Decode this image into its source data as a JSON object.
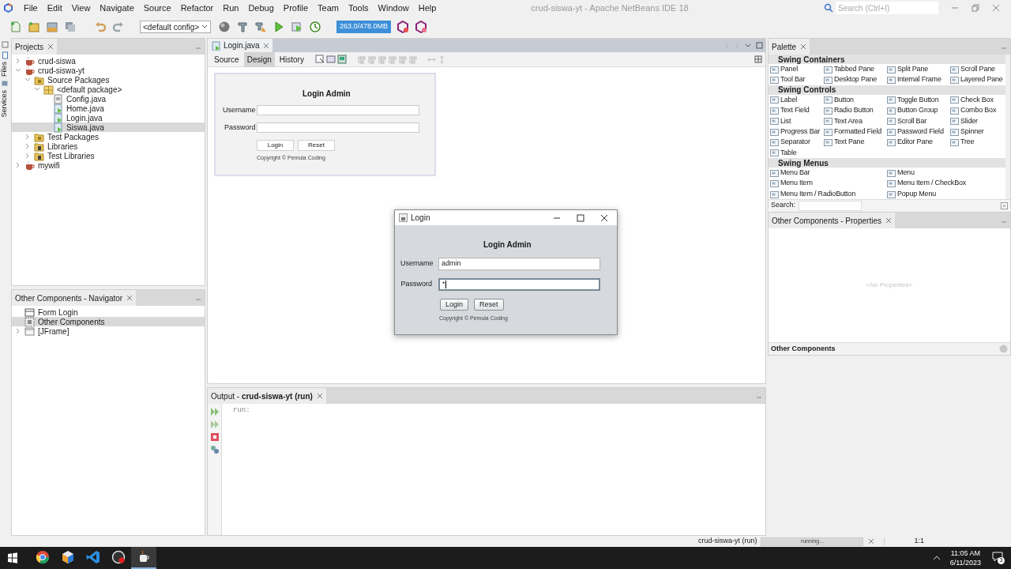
{
  "window": {
    "title": "crud-siswa-yt - Apache NetBeans IDE 18"
  },
  "menu": [
    "File",
    "Edit",
    "View",
    "Navigate",
    "Source",
    "Refactor",
    "Run",
    "Debug",
    "Profile",
    "Team",
    "Tools",
    "Window",
    "Help"
  ],
  "search": {
    "placeholder": "Search (Ctrl+I)"
  },
  "toolbar": {
    "config": "<default config>",
    "memory": "263.0/478.0MB"
  },
  "side_tabs": [
    "Files",
    "Services"
  ],
  "projects": {
    "title": "Projects",
    "tree": [
      {
        "label": "crud-siswa",
        "kind": "project",
        "expanded": false,
        "selected": false
      },
      {
        "label": "crud-siswa-yt",
        "kind": "project",
        "expanded": true,
        "selected": false,
        "children": [
          {
            "label": "Source Packages",
            "kind": "folder",
            "expanded": true,
            "selected": false,
            "children": [
              {
                "label": "<default package>",
                "kind": "package",
                "expanded": true,
                "selected": false,
                "children": [
                  {
                    "label": "Config.java",
                    "kind": "class",
                    "selected": false
                  },
                  {
                    "label": "Home.java",
                    "kind": "form",
                    "selected": false
                  },
                  {
                    "label": "Login.java",
                    "kind": "form",
                    "selected": false
                  },
                  {
                    "label": "Siswa.java",
                    "kind": "form",
                    "selected": true
                  }
                ]
              }
            ]
          },
          {
            "label": "Test Packages",
            "kind": "folder",
            "expanded": false,
            "selected": false
          },
          {
            "label": "Libraries",
            "kind": "library",
            "expanded": false,
            "selected": false
          },
          {
            "label": "Test Libraries",
            "kind": "library",
            "expanded": false,
            "selected": false
          }
        ]
      },
      {
        "label": "mywifi",
        "kind": "project",
        "expanded": false,
        "selected": false
      }
    ]
  },
  "navigator": {
    "title": "Other Components - Navigator",
    "tree": [
      {
        "label": "Form Login",
        "kind": "formroot",
        "selected": false
      },
      {
        "label": "Other Components",
        "kind": "component",
        "selected": true
      },
      {
        "label": "[JFrame]",
        "kind": "frame",
        "expanded": false,
        "selected": false
      }
    ]
  },
  "editor": {
    "tabs": [
      {
        "label": "Login.java",
        "selected": true
      }
    ],
    "views": [
      {
        "label": "Source",
        "selected": false
      },
      {
        "label": "Design",
        "selected": true
      },
      {
        "label": "History",
        "selected": false
      }
    ],
    "form": {
      "heading": "Login Admin",
      "fields": [
        {
          "label": "Username"
        },
        {
          "label": "Password"
        }
      ],
      "buttons": [
        "Login",
        "Reset"
      ],
      "copyright": "Copyright © Pemula Coding"
    }
  },
  "running_app": {
    "title": "Login",
    "heading": "Login Admin",
    "fields": [
      {
        "label": "Username",
        "value": "admin",
        "focused": false
      },
      {
        "label": "Password",
        "value": "*",
        "focused": true
      }
    ],
    "buttons": [
      "Login",
      "Reset"
    ],
    "copyright": "Copyright © Pemula Coding"
  },
  "palette": {
    "title": "Palette",
    "sections": [
      {
        "title": "Swing Containers",
        "kind": "grid4",
        "items": [
          "Panel",
          "Tabbed Pane",
          "Split Pane",
          "Scroll Pane",
          "Tool Bar",
          "Desktop Pane",
          "Internal Frame",
          "Layered Pane"
        ]
      },
      {
        "title": "Swing Controls",
        "kind": "grid4",
        "items": [
          "Label",
          "Button",
          "Toggle Button",
          "Check Box",
          "Text Field",
          "Radio Button",
          "Button Group",
          "Combo Box",
          "List",
          "Text Area",
          "Scroll Bar",
          "Slider",
          "Progress Bar",
          "Formatted Field",
          "Password Field",
          "Spinner",
          "Separator",
          "Text Pane",
          "Editor Pane",
          "Tree",
          "Table"
        ]
      },
      {
        "title": "Swing Menus",
        "kind": "grid2",
        "items": [
          "Menu Bar",
          "Menu",
          "Menu Item",
          "Menu Item / CheckBox",
          "Menu Item / RadioButton",
          "Popup Menu"
        ]
      }
    ],
    "search_label": "Search:"
  },
  "properties": {
    "title": "Other Components - Properties",
    "empty_text": "<No Properties>",
    "footer": "Other Components"
  },
  "output": {
    "title": "Output - **crud-siswa-yt (run)**",
    "lines": [
      "run:"
    ]
  },
  "status_bar": {
    "task": "crud-siswa-yt (run)",
    "progress_text": "running...",
    "level": 1,
    "position": "1:1"
  },
  "taskbar": {
    "apps": [
      {
        "kind": "browser",
        "selected": false
      },
      {
        "kind": "cube",
        "selected": false
      },
      {
        "kind": "editor",
        "selected": false
      },
      {
        "kind": "recorder",
        "selected": false
      },
      {
        "kind": "java",
        "selected": true
      }
    ],
    "time": "11:05 AM",
    "date": "6/11/2023",
    "notifications": "3"
  }
}
